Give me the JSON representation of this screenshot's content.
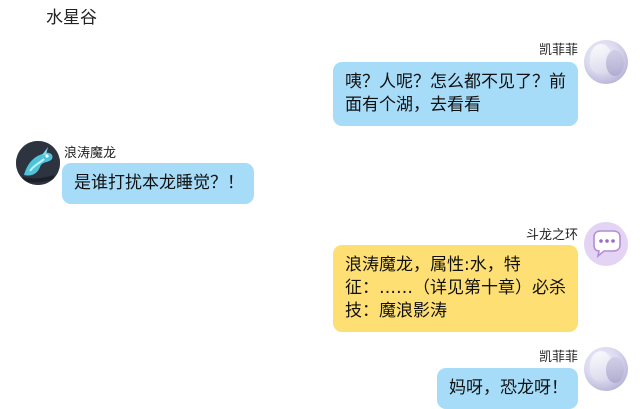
{
  "header": {
    "title": "水星谷"
  },
  "messages": [
    {
      "sender": "凯菲菲",
      "text": "咦？人呢？怎么都不见了？前面有个湖，去看看",
      "side": "right",
      "bubble_color": "#a6dcf8",
      "avatar_icon": "fairy-avatar-icon"
    },
    {
      "sender": "浪涛魔龙",
      "text": "是谁打扰本龙睡觉？！",
      "side": "left",
      "bubble_color": "#a6dcf8",
      "avatar_icon": "dragon-avatar-icon"
    },
    {
      "sender": "斗龙之环",
      "text": "浪涛魔龙，属性:水，特征：……（详见第十章）必杀技：魔浪影涛",
      "side": "right",
      "bubble_color": "#fedf73",
      "avatar_icon": "chat-bubble-avatar-icon"
    },
    {
      "sender": "凯菲菲",
      "text": "妈呀，恐龙呀！",
      "side": "right",
      "bubble_color": "#a6dcf8",
      "avatar_icon": "fairy-avatar-icon"
    }
  ]
}
